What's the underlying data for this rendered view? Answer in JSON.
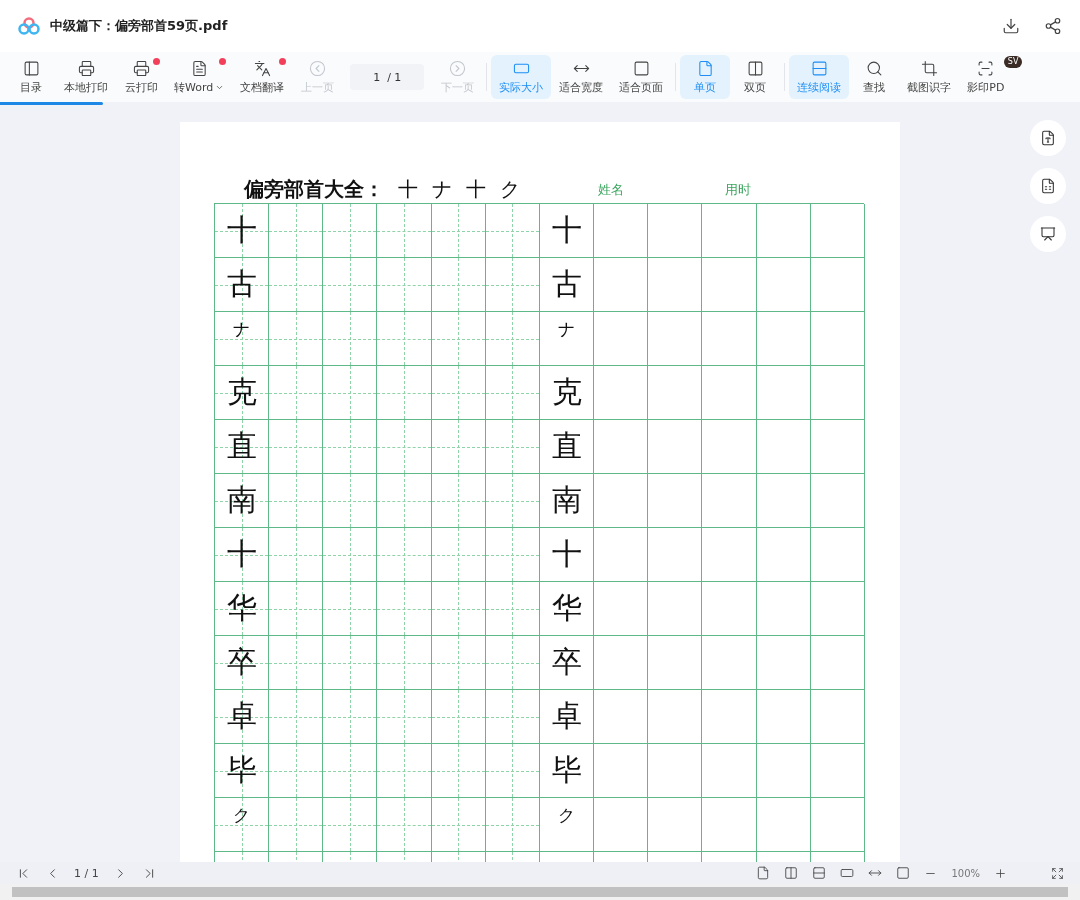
{
  "title": "中级篇下：偏旁部首59页.pdf",
  "toolbar": [
    {
      "kind": "toc",
      "label": "目录",
      "selected": false,
      "disabled": false
    },
    {
      "kind": "print",
      "label": "本地打印",
      "selected": false,
      "disabled": false
    },
    {
      "kind": "cloud-print",
      "label": "云打印",
      "selected": false,
      "disabled": false,
      "badge": true
    },
    {
      "kind": "word",
      "label": "转Word",
      "selected": false,
      "disabled": false,
      "badge": true,
      "dropdown": true
    },
    {
      "kind": "translate",
      "label": "文档翻译",
      "selected": false,
      "disabled": false,
      "badge": true
    },
    {
      "kind": "prev",
      "label": "上一页",
      "selected": false,
      "disabled": true
    },
    {
      "kind": "page-field",
      "value": "1  / 1"
    },
    {
      "kind": "next",
      "label": "下一页",
      "selected": false,
      "disabled": true
    },
    {
      "kind": "divider"
    },
    {
      "kind": "actual",
      "label": "实际大小",
      "selected": true,
      "disabled": false
    },
    {
      "kind": "fit-width",
      "label": "适合宽度",
      "selected": false,
      "disabled": false
    },
    {
      "kind": "fit-page",
      "label": "适合页面",
      "selected": false,
      "disabled": false
    },
    {
      "kind": "divider"
    },
    {
      "kind": "single",
      "label": "单页",
      "selected": true,
      "disabled": false
    },
    {
      "kind": "double",
      "label": "双页",
      "selected": false,
      "disabled": false
    },
    {
      "kind": "divider"
    },
    {
      "kind": "continuous",
      "label": "连续阅读",
      "selected": true,
      "disabled": false
    },
    {
      "kind": "search",
      "label": "查找",
      "selected": false,
      "disabled": false
    },
    {
      "kind": "ocr",
      "label": "截图识字",
      "selected": false,
      "disabled": false
    },
    {
      "kind": "scan",
      "label": "影印PD",
      "selected": false,
      "disabled": false,
      "tag": "SV"
    }
  ],
  "loading": {
    "level": 0.095
  },
  "side_tools": [
    {
      "kind": "word"
    },
    {
      "kind": "excel"
    },
    {
      "kind": "ppt"
    }
  ],
  "worksheet": {
    "title": "偏旁部首大全：",
    "radicals": [
      "十",
      "ナ",
      "十",
      "ク"
    ],
    "name_label": "姓名",
    "time_label": "用时",
    "rows": [
      {
        "left": "十",
        "right": "十",
        "small": false
      },
      {
        "left": "古",
        "right": "古",
        "small": false
      },
      {
        "left": "ナ",
        "right": "ナ",
        "small": true
      },
      {
        "left": "克",
        "right": "克",
        "small": false
      },
      {
        "left": "直",
        "right": "直",
        "small": false
      },
      {
        "left": "南",
        "right": "南",
        "small": false
      },
      {
        "left": "十",
        "right": "十",
        "small": false
      },
      {
        "left": "华",
        "right": "华",
        "small": false
      },
      {
        "left": "卒",
        "right": "卒",
        "small": false
      },
      {
        "left": "卓",
        "right": "卓",
        "small": false
      },
      {
        "left": "毕",
        "right": "毕",
        "small": false
      },
      {
        "left": "ク",
        "right": "ク",
        "small": true
      }
    ]
  },
  "bottom_bar": {
    "page": "1 / 1",
    "zoom": "100%"
  }
}
